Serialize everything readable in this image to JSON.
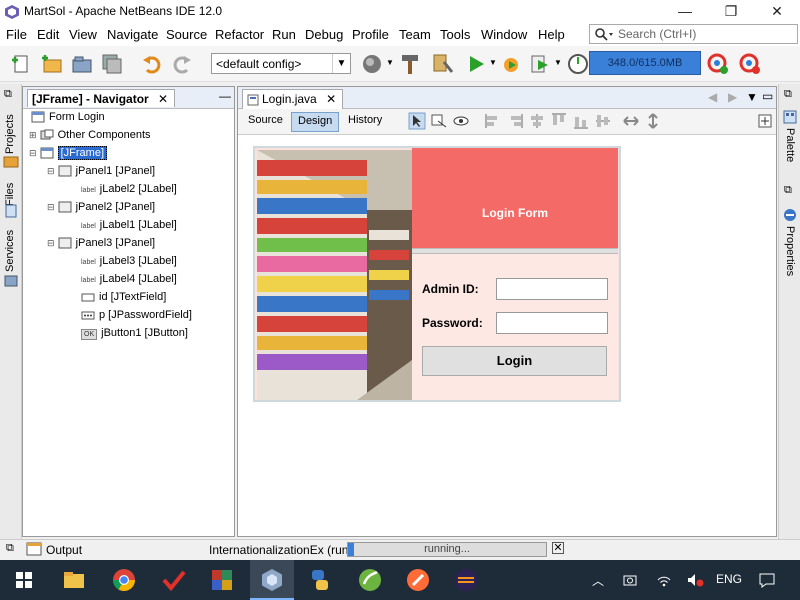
{
  "window": {
    "title": "MartSol - Apache NetBeans IDE 12.0",
    "minimize": "—",
    "maximize": "❐",
    "close": "✕"
  },
  "menu": [
    "File",
    "Edit",
    "View",
    "Navigate",
    "Source",
    "Refactor",
    "Run",
    "Debug",
    "Profile",
    "Team",
    "Tools",
    "Window",
    "Help"
  ],
  "search": {
    "placeholder": "Search (Ctrl+I)"
  },
  "toolbar": {
    "config": "<default config>",
    "memory": "348.0/615.0MB"
  },
  "left_strip": {
    "tabs": [
      "Projects",
      "Files",
      "Services"
    ]
  },
  "navigator": {
    "title": "[JFrame] - Navigator",
    "tree": [
      {
        "label": "Form Login",
        "level": 0,
        "kind": "form"
      },
      {
        "label": "Other Components",
        "level": 0,
        "kind": "folder"
      },
      {
        "label": "[JFrame]",
        "level": 0,
        "kind": "frame",
        "selected": true
      },
      {
        "label": "jPanel1 [JPanel]",
        "level": 1,
        "kind": "panel"
      },
      {
        "label": "jLabel2 [JLabel]",
        "level": 2,
        "kind": "label"
      },
      {
        "label": "jPanel2 [JPanel]",
        "level": 1,
        "kind": "panel"
      },
      {
        "label": "jLabel1 [JLabel]",
        "level": 2,
        "kind": "label"
      },
      {
        "label": "jPanel3 [JPanel]",
        "level": 1,
        "kind": "panel"
      },
      {
        "label": "jLabel3 [JLabel]",
        "level": 2,
        "kind": "label"
      },
      {
        "label": "jLabel4 [JLabel]",
        "level": 2,
        "kind": "label"
      },
      {
        "label": "id [JTextField]",
        "level": 2,
        "kind": "textfield"
      },
      {
        "label": "p [JPasswordField]",
        "level": 2,
        "kind": "password"
      },
      {
        "label": "jButton1 [JButton]",
        "level": 2,
        "kind": "button"
      }
    ],
    "label_icon_text": "label",
    "button_icon_text": "OK"
  },
  "editor": {
    "tab": "Login.java",
    "modes": [
      "Source",
      "Design",
      "History"
    ],
    "active_mode": "Design"
  },
  "form": {
    "title": "Login Form",
    "admin_label": "Admin ID:",
    "password_label": "Password:",
    "button": "Login"
  },
  "right_strip": {
    "tabs": [
      "Palette",
      "Properties"
    ]
  },
  "status": {
    "output": "Output",
    "task": "InternationalizationEx (run)",
    "progress_text": "running..."
  },
  "taskbar": {
    "language": "ENG"
  },
  "colors": {
    "form_header": "#f46a66",
    "selection": "#2a6bd1",
    "memory_bar": "#3a7fd8",
    "taskbar": "#1e2b38"
  }
}
